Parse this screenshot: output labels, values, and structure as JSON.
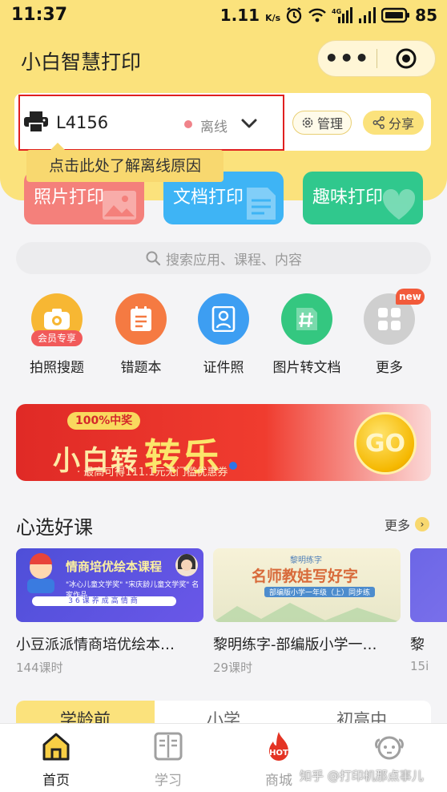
{
  "status_bar": {
    "time": "11:37",
    "speed": "1.11",
    "speed_unit": "K/s",
    "net_label": "4G",
    "battery": "85"
  },
  "app": {
    "title": "小白智慧打印",
    "menu_dots": "•••"
  },
  "printer": {
    "name": "L4156",
    "status": "离线",
    "manage_label": "管理",
    "share_label": "分享"
  },
  "tooltip": {
    "text": "点击此处了解离线原因"
  },
  "functions": [
    {
      "label": "照片打印",
      "color": "#f4807b"
    },
    {
      "label": "文档打印",
      "color": "#3eb4f5"
    },
    {
      "label": "趣味打印",
      "color": "#30c88d"
    }
  ],
  "search": {
    "placeholder": "搜索应用、课程、内容"
  },
  "apps": [
    {
      "label": "拍照搜题",
      "tag": "会员专享",
      "icon": "camera-icon",
      "color": "#f7b733"
    },
    {
      "label": "错题本",
      "icon": "notebook-icon",
      "color": "#f57a42"
    },
    {
      "label": "证件照",
      "icon": "id-photo-icon",
      "color": "#3d9ef2"
    },
    {
      "label": "图片转文档",
      "icon": "hash-document-icon",
      "color": "#34c780"
    },
    {
      "label": "更多",
      "badge": "new",
      "icon": "grid-icon",
      "color": "#cfcfcf"
    }
  ],
  "banner": {
    "pill": "100%中奖",
    "title_a": "小白转",
    "title_b": "转乐",
    "subtitle": "· 最高可得111.1元无门槛优惠券",
    "go_label": "GO"
  },
  "courses_section": {
    "title": "心选好课",
    "more_label": "更多"
  },
  "courses": [
    {
      "title": "小豆派派情商培优绘本…",
      "meta": "144课时",
      "thumb_title": "情商培优绘本课程",
      "thumb_sub": "\"冰心儿童文学奖\" \"宋庆龄儿童文学奖\" 名家作品",
      "thumb_strip": "36课养成高情商"
    },
    {
      "title": "黎明练字-部编版小学一…",
      "meta": "29课时",
      "thumb_brand": "黎明练字",
      "thumb_title": "名师教娃写好字",
      "thumb_sub": "部编版小学一年级（上）同步练"
    },
    {
      "title": "黎",
      "meta": "15i"
    }
  ],
  "grade_tabs": [
    "学龄前",
    "小学",
    "初高中"
  ],
  "tab_bar": [
    {
      "label": "首页",
      "icon": "home-icon",
      "active": true
    },
    {
      "label": "学习",
      "icon": "book-icon",
      "active": false
    },
    {
      "label": "商城",
      "icon": "hot-flame-icon",
      "active": false,
      "badge": "HOT"
    },
    {
      "label": "",
      "icon": "puppy-icon",
      "active": false
    }
  ],
  "watermark": "知乎 @打印机那点事儿"
}
